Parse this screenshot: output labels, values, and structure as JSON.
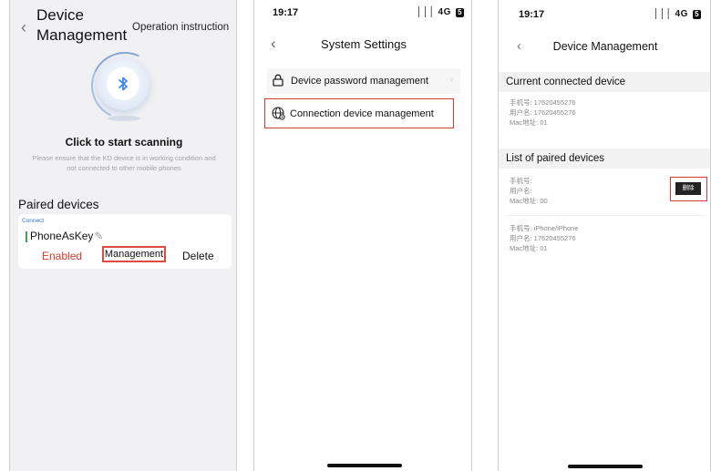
{
  "phone1": {
    "title": "Device Management",
    "operation_instruction": "Operation instruction",
    "scan_title": "Click to start scanning",
    "scan_hint": "Please ensure that the KD device is in working condition and not connected to other mobile phones",
    "paired_title": "Paired devices",
    "device": {
      "status": "Connect",
      "name": "PhoneAsKey",
      "enabled_label": "Enabled",
      "management_label": "Management",
      "delete_label": "Delete"
    }
  },
  "phone2": {
    "status_time": "19:17",
    "status_network": "4G",
    "status_battery": "5",
    "title": "System Settings",
    "items": [
      {
        "label": "Device password management",
        "icon": "lock-icon"
      },
      {
        "label": "Connection device management",
        "icon": "globe-settings-icon"
      }
    ]
  },
  "phone3": {
    "status_time": "19:17",
    "status_network": "4G",
    "status_battery": "5",
    "title": "Device Management",
    "current_header": "Current connected device",
    "current": {
      "phone": "手机号: 17620455276",
      "user": "用户名: 17620455276",
      "mac": "Mac地址: 01"
    },
    "paired_header": "List of paired devices",
    "paired": [
      {
        "phone": "手机号:",
        "user": "用户名:",
        "mac": "Mac地址: 00"
      },
      {
        "phone": "手机号: iPhone/iPhone",
        "user": "用户名: 17620455276",
        "mac": "Mac地址: 01"
      }
    ],
    "delete_label": "删除"
  },
  "colors": {
    "accent_red": "#d13b2b",
    "highlight_border": "#d43a3a",
    "bluetooth_blue": "#3f86f0",
    "connected_green": "#39a852"
  }
}
